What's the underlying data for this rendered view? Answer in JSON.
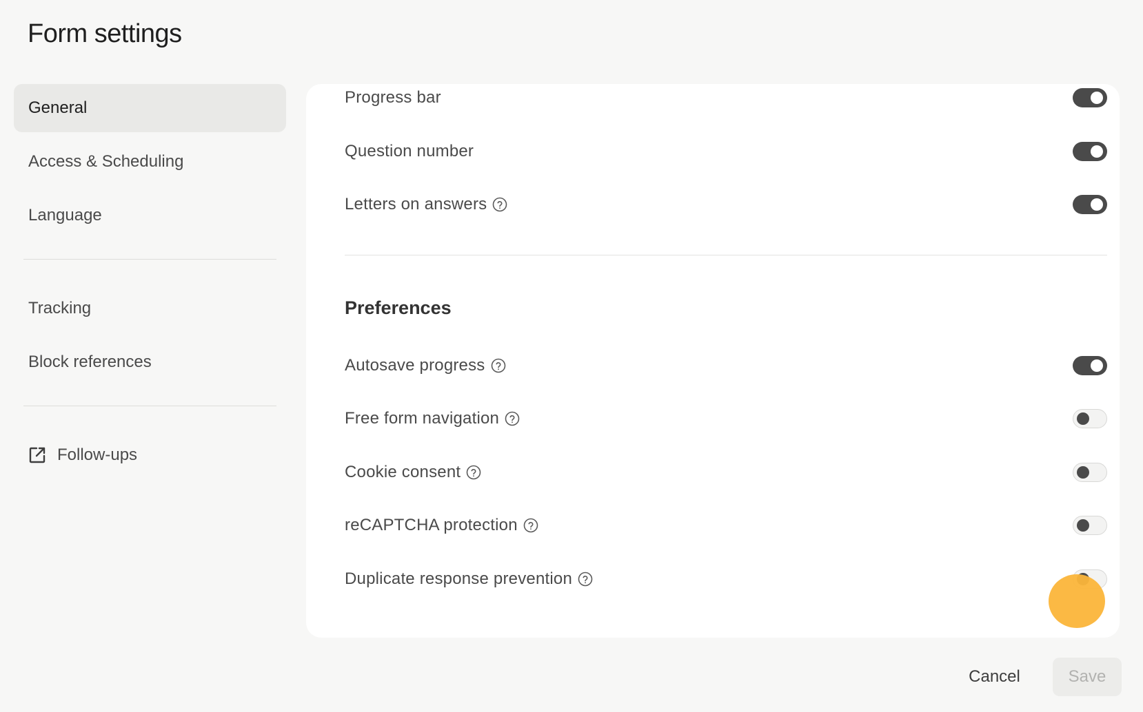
{
  "page": {
    "title": "Form settings"
  },
  "sidebar": {
    "items": [
      {
        "label": "General",
        "active": true
      },
      {
        "label": "Access & Scheduling",
        "active": false
      },
      {
        "label": "Language",
        "active": false
      },
      {
        "label": "Tracking",
        "active": false
      },
      {
        "label": "Block references",
        "active": false
      },
      {
        "label": "Follow-ups",
        "active": false,
        "icon": "external-link-icon"
      }
    ]
  },
  "display_settings": [
    {
      "label": "Progress bar",
      "enabled": true,
      "has_help": false
    },
    {
      "label": "Question number",
      "enabled": true,
      "has_help": false
    },
    {
      "label": "Letters on answers",
      "enabled": true,
      "has_help": true
    }
  ],
  "preferences": {
    "heading": "Preferences",
    "items": [
      {
        "label": "Autosave progress",
        "enabled": true,
        "has_help": true
      },
      {
        "label": "Free form navigation",
        "enabled": false,
        "has_help": true
      },
      {
        "label": "Cookie consent",
        "enabled": false,
        "has_help": true
      },
      {
        "label": "reCAPTCHA protection",
        "enabled": false,
        "has_help": true
      },
      {
        "label": "Duplicate response prevention",
        "enabled": false,
        "has_help": true
      }
    ]
  },
  "footer": {
    "cancel_label": "Cancel",
    "save_label": "Save",
    "save_enabled": false
  },
  "colors": {
    "background": "#f7f7f6",
    "panel": "#ffffff",
    "toggle_on": "#4a4a4a",
    "toggle_off": "#f3f3f2",
    "cursor_highlight": "#fbb53a"
  }
}
